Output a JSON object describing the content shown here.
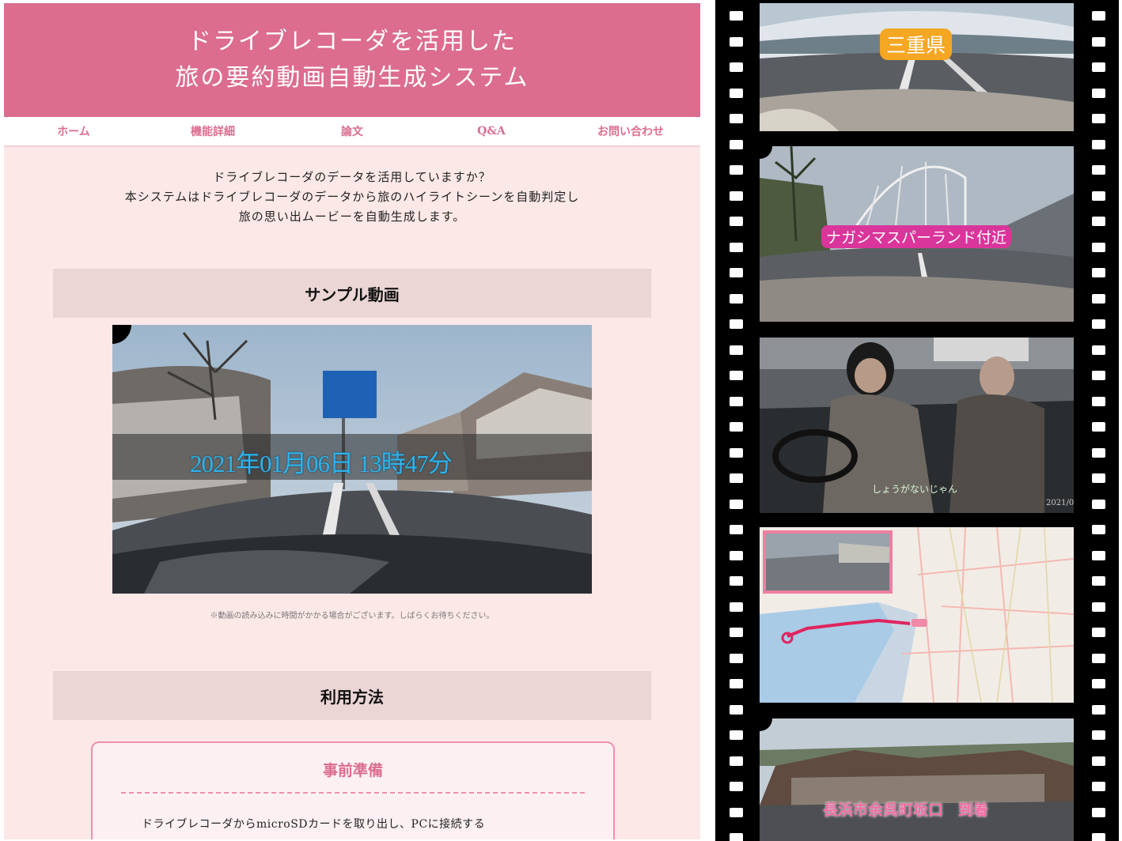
{
  "header": {
    "title_line1": "ドライブレコーダを活用した",
    "title_line2": "旅の要約動画自動生成システム"
  },
  "nav": [
    "ホーム",
    "機能詳細",
    "論文",
    "Q&A",
    "お問い合わせ"
  ],
  "intro": [
    "ドライブレコーダのデータを活用していますか？",
    "本システムはドライブレコーダのデータから旅のハイライトシーンを自動判定し",
    "旅の思い出ムービーを自動生成します。"
  ],
  "sample_section": "サンプル動画",
  "video": {
    "timestamp": "2021年01月06日 13時47分"
  },
  "note": "※動画の読み込みに時間がかかる場合がございます。しばらくお待ちください。",
  "usage_section": "利用方法",
  "prep": {
    "title": "事前準備",
    "step1": "ドライブレコーダからmicroSDカードを取り出し、PCに接続する"
  },
  "film": {
    "frame1_caption": "三重県",
    "frame2_caption": "ナガシマスパーランド付近",
    "frame3_caption": "しょうがないじゃん",
    "frame3_date": "2021/0",
    "frame5_caption": "長浜市余呉町坂口　到着"
  },
  "colors": {
    "header_pink": "#dc6d8f",
    "page_bg": "#fde8e8",
    "section_bg": "#ebd5d5",
    "timestamp": "#2fb3ea"
  }
}
